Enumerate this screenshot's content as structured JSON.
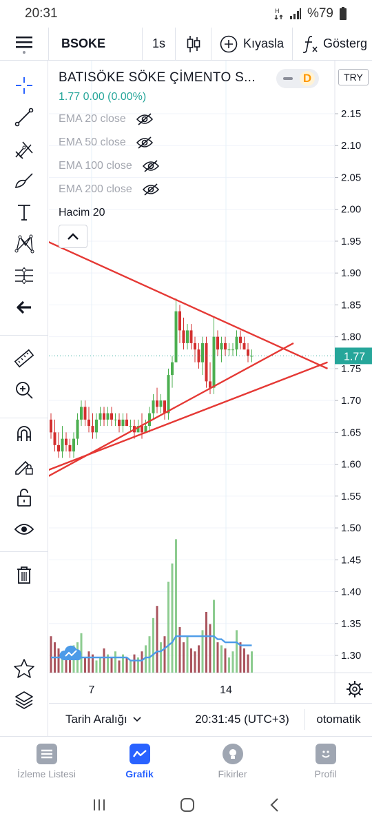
{
  "status": {
    "time": "20:31",
    "battery": "%79"
  },
  "topbar": {
    "symbol": "BSOKE",
    "interval": "1s",
    "compare_label": "Kıyasla",
    "indicators_label": "Gösterg"
  },
  "legend": {
    "title": "BATISÖKE SÖKE ÇİMENTO S...",
    "badge": "D",
    "price_line": "1.77  0.00 (0.00%)",
    "indicators": [
      "EMA 20 close",
      "EMA 50 close",
      "EMA 100 close",
      "EMA 200 close"
    ],
    "volume": "Hacim 20"
  },
  "price_axis": {
    "currency": "TRY",
    "ticks": [
      "2.15",
      "2.10",
      "2.05",
      "2.00",
      "1.95",
      "1.90",
      "1.85",
      "1.80",
      "1.75",
      "1.70",
      "1.65",
      "1.60",
      "1.55",
      "1.50",
      "1.45",
      "1.40",
      "1.35",
      "1.30"
    ],
    "last_price": "1.77"
  },
  "time_axis": {
    "ticks": [
      "7",
      "14"
    ]
  },
  "bottom": {
    "range_label": "Tarih Aralığı",
    "clock": "20:31:45 (UTC+3)",
    "scale": "otomatik"
  },
  "nav": [
    {
      "label": "İzleme Listesi"
    },
    {
      "label": "Grafik"
    },
    {
      "label": "Fikirler"
    },
    {
      "label": "Profil"
    }
  ],
  "colors": {
    "up": "#4caf50",
    "down": "#d32f2f",
    "trend": "#e53935",
    "accent": "#2962ff",
    "price_tag": "#26a69a",
    "ema_volume": "#4c9be8"
  },
  "chart_data": {
    "type": "candlestick",
    "ylim": [
      1.27,
      2.18
    ],
    "last_price": 1.77,
    "candles": [
      [
        1.67,
        1.68,
        1.64,
        1.65
      ],
      [
        1.65,
        1.67,
        1.62,
        1.63
      ],
      [
        1.63,
        1.65,
        1.61,
        1.62
      ],
      [
        1.62,
        1.66,
        1.61,
        1.64
      ],
      [
        1.64,
        1.65,
        1.62,
        1.63
      ],
      [
        1.63,
        1.64,
        1.61,
        1.62
      ],
      [
        1.62,
        1.65,
        1.61,
        1.64
      ],
      [
        1.64,
        1.68,
        1.63,
        1.67
      ],
      [
        1.67,
        1.7,
        1.66,
        1.69
      ],
      [
        1.69,
        1.7,
        1.66,
        1.67
      ],
      [
        1.67,
        1.69,
        1.65,
        1.66
      ],
      [
        1.66,
        1.68,
        1.64,
        1.65
      ],
      [
        1.65,
        1.68,
        1.64,
        1.67
      ],
      [
        1.67,
        1.69,
        1.66,
        1.68
      ],
      [
        1.68,
        1.69,
        1.66,
        1.67
      ],
      [
        1.67,
        1.69,
        1.66,
        1.68
      ],
      [
        1.68,
        1.69,
        1.66,
        1.67
      ],
      [
        1.67,
        1.68,
        1.66,
        1.67
      ],
      [
        1.67,
        1.68,
        1.65,
        1.66
      ],
      [
        1.66,
        1.68,
        1.65,
        1.67
      ],
      [
        1.67,
        1.68,
        1.66,
        1.66
      ],
      [
        1.66,
        1.67,
        1.65,
        1.66
      ],
      [
        1.66,
        1.67,
        1.64,
        1.65
      ],
      [
        1.65,
        1.67,
        1.65,
        1.66
      ],
      [
        1.66,
        1.68,
        1.64,
        1.65
      ],
      [
        1.65,
        1.67,
        1.65,
        1.66
      ],
      [
        1.66,
        1.69,
        1.65,
        1.68
      ],
      [
        1.68,
        1.71,
        1.67,
        1.7
      ],
      [
        1.7,
        1.72,
        1.68,
        1.69
      ],
      [
        1.69,
        1.71,
        1.68,
        1.7
      ],
      [
        1.7,
        1.7,
        1.67,
        1.68
      ],
      [
        1.68,
        1.75,
        1.67,
        1.74
      ],
      [
        1.74,
        1.77,
        1.72,
        1.76
      ],
      [
        1.76,
        1.86,
        1.76,
        1.84
      ],
      [
        1.84,
        1.85,
        1.79,
        1.81
      ],
      [
        1.81,
        1.83,
        1.78,
        1.79
      ],
      [
        1.79,
        1.82,
        1.78,
        1.81
      ],
      [
        1.81,
        1.82,
        1.78,
        1.79
      ],
      [
        1.79,
        1.8,
        1.76,
        1.78
      ],
      [
        1.78,
        1.79,
        1.75,
        1.76
      ],
      [
        1.76,
        1.8,
        1.74,
        1.79
      ],
      [
        1.79,
        1.8,
        1.72,
        1.73
      ],
      [
        1.73,
        1.76,
        1.71,
        1.72
      ],
      [
        1.72,
        1.83,
        1.71,
        1.8
      ],
      [
        1.8,
        1.81,
        1.77,
        1.78
      ],
      [
        1.78,
        1.8,
        1.76,
        1.79
      ],
      [
        1.79,
        1.8,
        1.77,
        1.78
      ],
      [
        1.78,
        1.79,
        1.77,
        1.78
      ],
      [
        1.78,
        1.79,
        1.77,
        1.78
      ],
      [
        1.78,
        1.81,
        1.77,
        1.8
      ],
      [
        1.8,
        1.81,
        1.78,
        1.79
      ],
      [
        1.79,
        1.8,
        1.78,
        1.78
      ],
      [
        1.78,
        1.79,
        1.76,
        1.77
      ],
      [
        1.77,
        1.78,
        1.76,
        1.77
      ]
    ],
    "volume_series": [
      0.12,
      0.1,
      0.08,
      0.07,
      0.05,
      0.06,
      0.09,
      0.1,
      0.13,
      0.05,
      0.07,
      0.06,
      0.04,
      0.05,
      0.08,
      0.06,
      0.05,
      0.07,
      0.04,
      0.06,
      0.05,
      0.04,
      0.06,
      0.05,
      0.07,
      0.09,
      0.12,
      0.18,
      0.22,
      0.1,
      0.12,
      0.3,
      0.36,
      0.44,
      0.15,
      0.1,
      0.12,
      0.08,
      0.07,
      0.09,
      0.14,
      0.2,
      0.16,
      0.24,
      0.1,
      0.09,
      0.08,
      0.05,
      0.07,
      0.14,
      0.1,
      0.08,
      0.06,
      0.07
    ],
    "ema_volume": [
      0.05,
      0.05,
      0.05,
      0.05,
      0.05,
      0.05,
      0.05,
      0.05,
      0.05,
      0.05,
      0.05,
      0.05,
      0.05,
      0.05,
      0.05,
      0.05,
      0.05,
      0.05,
      0.05,
      0.05,
      0.05,
      0.04,
      0.04,
      0.04,
      0.04,
      0.05,
      0.05,
      0.06,
      0.07,
      0.07,
      0.08,
      0.09,
      0.1,
      0.12,
      0.12,
      0.12,
      0.12,
      0.12,
      0.12,
      0.12,
      0.12,
      0.12,
      0.12,
      0.12,
      0.11,
      0.11,
      0.1,
      0.1,
      0.1,
      0.1,
      0.09,
      0.09,
      0.09,
      0.09
    ],
    "trendlines": [
      {
        "x1": 0,
        "y1": 1.95,
        "x2": 73,
        "y2": 1.75
      },
      {
        "x1": 0,
        "y1": 1.58,
        "x2": 64,
        "y2": 1.79
      },
      {
        "x1": 0,
        "y1": 1.59,
        "x2": 73,
        "y2": 1.76
      }
    ]
  }
}
